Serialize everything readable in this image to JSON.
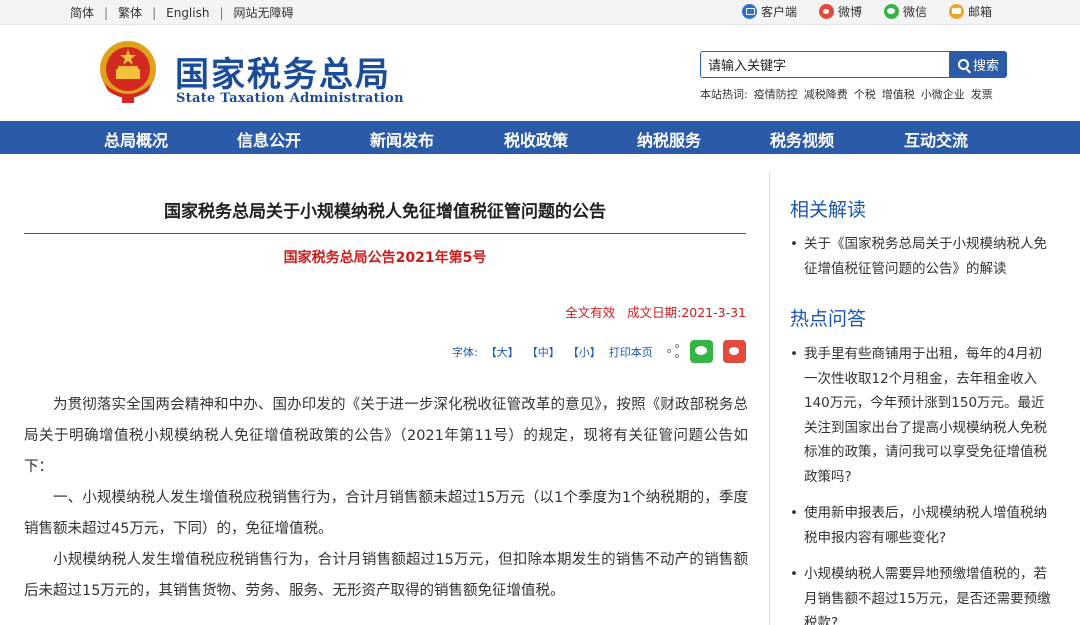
{
  "topbar": {
    "links": [
      "简体",
      "繁体",
      "English",
      "网站无障碍"
    ],
    "social": [
      {
        "label": "客户端",
        "icon": "client-icon"
      },
      {
        "label": "微博",
        "icon": "weibo-icon"
      },
      {
        "label": "微信",
        "icon": "wechat-icon"
      },
      {
        "label": "邮箱",
        "icon": "mail-icon"
      }
    ]
  },
  "header": {
    "title_cn": "国家税务总局",
    "title_en": "State Taxation Administration",
    "search_value": "请输入关键字",
    "search_button": "搜索",
    "hotwords_label": "本站热词:",
    "hotwords": [
      "疫情防控",
      "减税降费",
      "个税",
      "增值税",
      "小微企业",
      "发票"
    ]
  },
  "nav": {
    "items": [
      "总局概况",
      "信息公开",
      "新闻发布",
      "税收政策",
      "纳税服务",
      "税务视频",
      "互动交流"
    ]
  },
  "article": {
    "title": "国家税务总局关于小规模纳税人免征增值税征管问题的公告",
    "subtitle": "国家税务总局公告2021年第5号",
    "validity": "全文有效",
    "date": "成文日期:2021-3-31",
    "font_label": "字体:",
    "font_large": "【大】",
    "font_medium": "【中】",
    "font_small": "【小】",
    "print": "打印本页",
    "paragraphs": [
      "为贯彻落实全国两会精神和中办、国办印发的《关于进一步深化税收征管改革的意见》，按照《财政部税务总局关于明确增值税小规模纳税人免征增值税政策的公告》（2021年第11号）的规定，现将有关征管问题公告如下：",
      "一、小规模纳税人发生增值税应税销售行为，合计月销售额未超过15万元（以1个季度为1个纳税期的，季度销售额未超过45万元，下同）的，免征增值税。",
      "小规模纳税人发生增值税应税销售行为，合计月销售额超过15万元，但扣除本期发生的销售不动产的销售额后未超过15万元的，其销售货物、劳务、服务、无形资产取得的销售额免征增值税。"
    ]
  },
  "sidebar": {
    "related_title": "相关解读",
    "related": [
      "关于《国家税务总局关于小规模纳税人免征增值税征管问题的公告》的解读"
    ],
    "faq_title": "热点问答",
    "faq": [
      "我手里有些商铺用于出租，每年的4月初一次性收取12个月租金，去年租金收入140万元，今年预计涨到150万元。最近关注到国家出台了提高小规模纳税人免税标准的政策，请问我可以享受免征增值税政策吗?",
      "使用新申报表后，小规模纳税人增值税纳税申报内容有哪些变化?",
      "小规模纳税人需要异地预缴增值税的，若月销售额不超过15万元，是否还需要预缴税款?"
    ]
  },
  "colors": {
    "brand_blue": "#2a5aa8",
    "title_blue": "#1b4c9a",
    "accent_red": "#c8201f"
  }
}
